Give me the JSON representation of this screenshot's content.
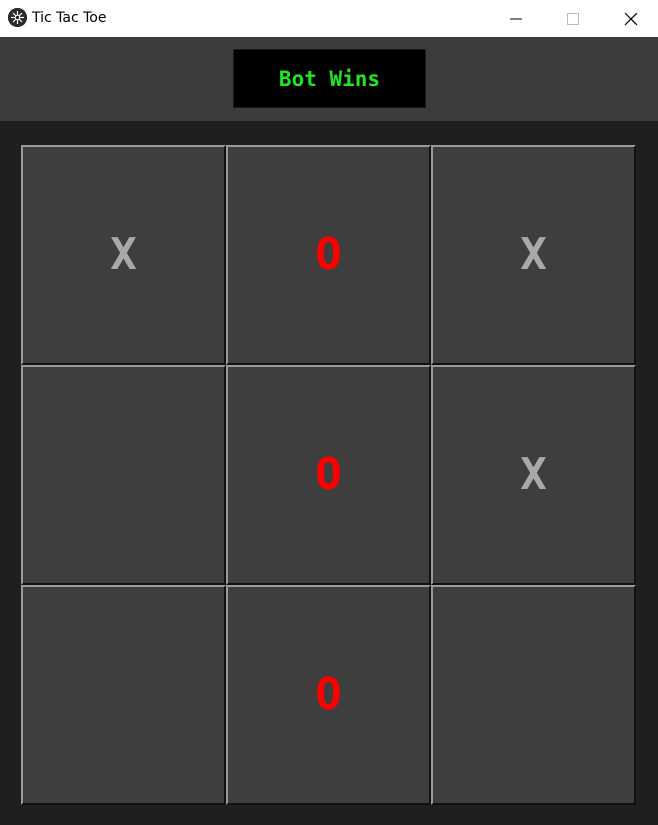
{
  "window": {
    "title": "Tic Tac Toe"
  },
  "status": {
    "text": "Bot Wins",
    "color": "#1fe61f"
  },
  "colors": {
    "x_mark": "#a9a9a9",
    "o_mark": "#ff0000",
    "cell_bg": "#3e3e3e",
    "header_bg": "#3c3c3c",
    "board_bg": "#1f1f1f"
  },
  "board": {
    "cells": [
      "X",
      "O",
      "X",
      "",
      "O",
      "X",
      "",
      "O",
      ""
    ]
  }
}
